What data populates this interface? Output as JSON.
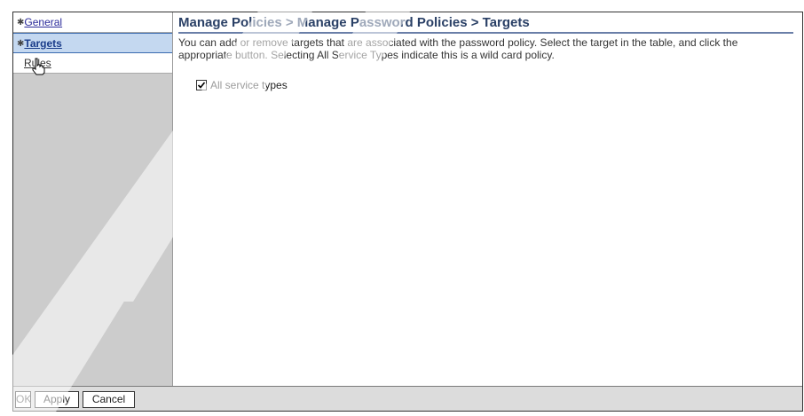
{
  "sidebar": {
    "items": [
      {
        "label": "General",
        "selected": false,
        "required": true
      },
      {
        "label": "Targets",
        "selected": true,
        "required": true
      },
      {
        "label": "Rules",
        "selected": false,
        "required": false
      }
    ]
  },
  "main": {
    "title": "Manage Policies > Manage Password Policies > Targets",
    "description": "You can add or remove targets that are associated with the password policy. Select the target in the table, and click the appropriate button. Selecting All Service Types indicate this is a wild card policy.",
    "checkbox_label": "All service types",
    "checkbox_checked": true
  },
  "footer": {
    "ok_label": "OK",
    "apply_label": "Apply",
    "cancel_label": "Cancel"
  },
  "colors": {
    "selected_bg": "#c4d8f0",
    "sidebar_bg": "#cccccc",
    "title_color": "#2a4066"
  }
}
